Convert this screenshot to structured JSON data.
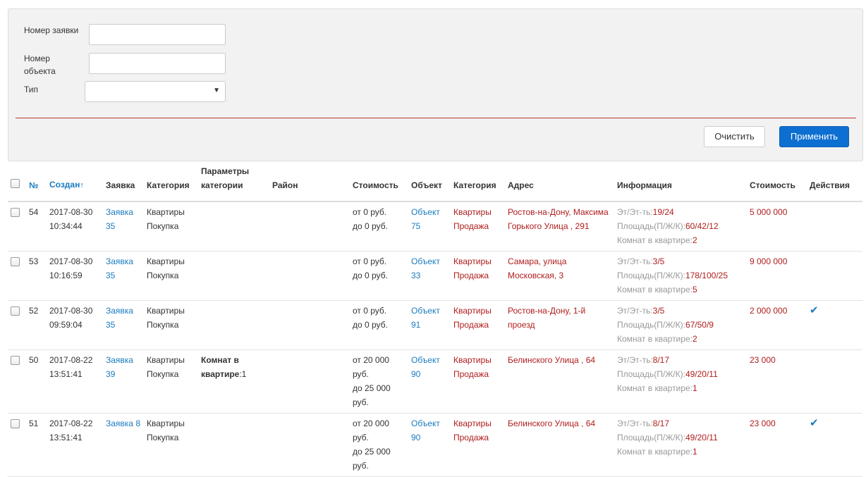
{
  "filters": {
    "request_number_label": "Номер заявки",
    "request_number_value": "",
    "object_number_label_1": "Номер",
    "object_number_label_2": "объекта",
    "object_number_value": "",
    "type_label": "Тип",
    "type_value": "",
    "clear_button": "Очистить",
    "apply_button": "Применить"
  },
  "table": {
    "headers": {
      "number": "№",
      "created": "Создан",
      "request": "Заявка",
      "category": "Категория",
      "params_1": "Параметры",
      "params_2": "категории",
      "district": "Район",
      "price": "Стоимость",
      "object": "Объект",
      "category2": "Категория",
      "address": "Адрес",
      "info": "Информация",
      "cost": "Стоимость",
      "actions": "Действия"
    },
    "rows": [
      {
        "num": "54",
        "date": "2017-08-30",
        "time": "10:34:44",
        "request": "Заявка 35",
        "cat1": "Квартиры",
        "cat2": "Покупка",
        "param_label": "",
        "param_value": "",
        "district": "",
        "price_lines": [
          "от 0 руб.",
          "до 0 руб."
        ],
        "obj1": "Объект",
        "obj2": "75",
        "ocat1": "Квартиры",
        "ocat2": "Продажа",
        "address_lines": [
          "Ростов-на-Дону, Максима",
          "Горького Улица , 291"
        ],
        "floor_label": "Эт/Эт-ть:",
        "floor": "19/24",
        "area_label": "Площадь(П/Ж/К):",
        "area": "60/42/12",
        "rooms_label": "Комнат в квартире:",
        "rooms": "2",
        "cost": "5 000 000",
        "action": ""
      },
      {
        "num": "53",
        "date": "2017-08-30",
        "time": "10:16:59",
        "request": "Заявка 35",
        "cat1": "Квартиры",
        "cat2": "Покупка",
        "param_label": "",
        "param_value": "",
        "district": "",
        "price_lines": [
          "от 0 руб.",
          "до 0 руб."
        ],
        "obj1": "Объект",
        "obj2": "33",
        "ocat1": "Квартиры",
        "ocat2": "Продажа",
        "address_lines": [
          "Самара, улица",
          "Московская, 3"
        ],
        "floor_label": "Эт/Эт-ть:",
        "floor": "3/5",
        "area_label": "Площадь(П/Ж/К):",
        "area": "178/100/25",
        "rooms_label": "Комнат в квартире:",
        "rooms": "5",
        "cost": "9 000 000",
        "action": ""
      },
      {
        "num": "52",
        "date": "2017-08-30",
        "time": "09:59:04",
        "request": "Заявка 35",
        "cat1": "Квартиры",
        "cat2": "Покупка",
        "param_label": "",
        "param_value": "",
        "district": "",
        "price_lines": [
          "от 0 руб.",
          "до 0 руб."
        ],
        "obj1": "Объект",
        "obj2": "91",
        "ocat1": "Квартиры",
        "ocat2": "Продажа",
        "address_lines": [
          "Ростов-на-Дону, 1-й",
          "проезд"
        ],
        "floor_label": "Эт/Эт-ть:",
        "floor": "3/5",
        "area_label": "Площадь(П/Ж/К):",
        "area": "67/50/9",
        "rooms_label": "Комнат в квартире:",
        "rooms": "2",
        "cost": "2 000 000",
        "action": "✔"
      },
      {
        "num": "50",
        "date": "2017-08-22",
        "time": "13:51:41",
        "request": "Заявка 39",
        "cat1": "Квартиры",
        "cat2": "Покупка",
        "param_label": "Комнат в квартире",
        "param_value": ":1",
        "district": "",
        "price_lines": [
          "от 20 000",
          "руб.",
          "до 25 000",
          "руб."
        ],
        "obj1": "Объект",
        "obj2": "90",
        "ocat1": "Квартиры",
        "ocat2": "Продажа",
        "address_lines": [
          "Белинского Улица , 64"
        ],
        "floor_label": "Эт/Эт-ть:",
        "floor": "8/17",
        "area_label": "Площадь(П/Ж/К):",
        "area": "49/20/11",
        "rooms_label": "Комнат в квартире:",
        "rooms": "1",
        "cost": "23 000",
        "action": ""
      },
      {
        "num": "51",
        "date": "2017-08-22",
        "time": "13:51:41",
        "request": "Заявка 8",
        "cat1": "Квартиры",
        "cat2": "Покупка",
        "param_label": "",
        "param_value": "",
        "district": "",
        "price_lines": [
          "от 20 000",
          "руб.",
          "до 25 000",
          "руб."
        ],
        "obj1": "Объект",
        "obj2": "90",
        "ocat1": "Квартиры",
        "ocat2": "Продажа",
        "address_lines": [
          "Белинского Улица , 64"
        ],
        "floor_label": "Эт/Эт-ть:",
        "floor": "8/17",
        "area_label": "Площадь(П/Ж/К):",
        "area": "49/20/11",
        "rooms_label": "Комнат в квартире:",
        "rooms": "1",
        "cost": "23 000",
        "action": "✔"
      }
    ]
  }
}
